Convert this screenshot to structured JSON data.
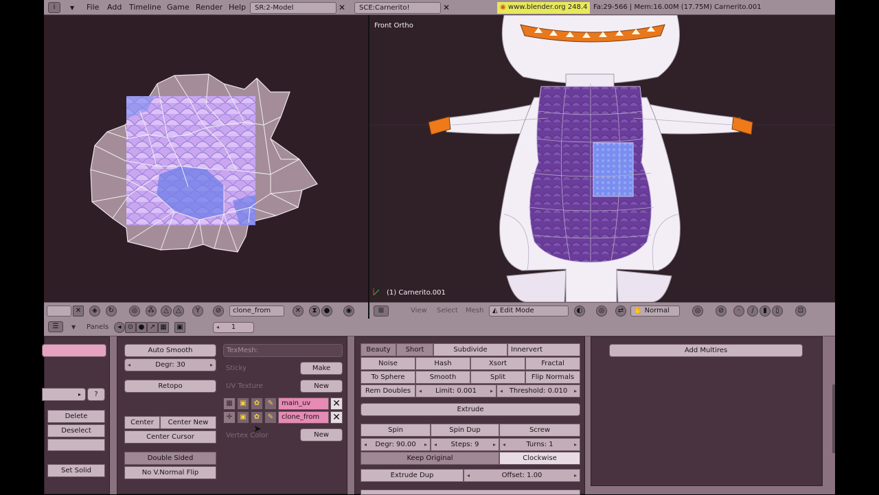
{
  "menubar": {
    "items": [
      "File",
      "Add",
      "Timeline",
      "Game",
      "Render",
      "Help"
    ],
    "screen": "SR:2-Model",
    "scene": "SCE:Carnerito!",
    "url": "www.blender.org 248.4",
    "stats": "Fa:29-566 | Mem:16.00M (17.75M) Carnerito.001"
  },
  "uv_editor": {
    "image_name": "clone_from"
  },
  "viewport": {
    "view_label": "Front Ortho",
    "object_label": "(1) Carnerito.001",
    "menus": [
      "View",
      "Select",
      "Mesh"
    ],
    "mode": "Edit Mode",
    "orientation": "Normal"
  },
  "buttons_header": {
    "panels_label": "Panels",
    "frame": "1"
  },
  "link_panel": {
    "delete": "Delete",
    "deselect": "Deselect",
    "set_solid": "Set Solid",
    "help": "?"
  },
  "mesh_panel": {
    "auto_smooth": "Auto Smooth",
    "degr": "Degr: 30",
    "retopo": "Retopo",
    "center": "Center",
    "center_new": "Center New",
    "center_cursor": "Center Cursor",
    "double_sided": "Double Sided",
    "no_vnormal_flip": "No V.Normal Flip",
    "texmesh": "TexMesh:",
    "sticky": "Sticky",
    "make": "Make",
    "uv_texture": "UV Texture",
    "new1": "New",
    "uv_layers": [
      "main_uv",
      "clone_from"
    ],
    "vertex_color": "Vertex Color",
    "new2": "New"
  },
  "mesh_tools": {
    "beauty": "Beauty",
    "short": "Short",
    "subdivide": "Subdivide",
    "innervert": "Innervert",
    "noise": "Noise",
    "hash": "Hash",
    "xsort": "Xsort",
    "fractal": "Fractal",
    "to_sphere": "To Sphere",
    "smooth": "Smooth",
    "split": "Split",
    "flip_normals": "Flip Normals",
    "rem_doubles": "Rem Doubles",
    "limit": "Limit: 0.001",
    "threshold": "Threshold: 0.010",
    "extrude": "Extrude",
    "spin": "Spin",
    "spin_dup": "Spin Dup",
    "screw": "Screw",
    "spin_degr": "Degr: 90.00",
    "steps": "Steps: 9",
    "turns": "Turns: 1",
    "keep_original": "Keep Original",
    "clockwise": "Clockwise",
    "extrude_dup": "Extrude Dup",
    "offset": "Offset: 1.00"
  },
  "modifiers": {
    "add_multires": "Add Multires"
  }
}
